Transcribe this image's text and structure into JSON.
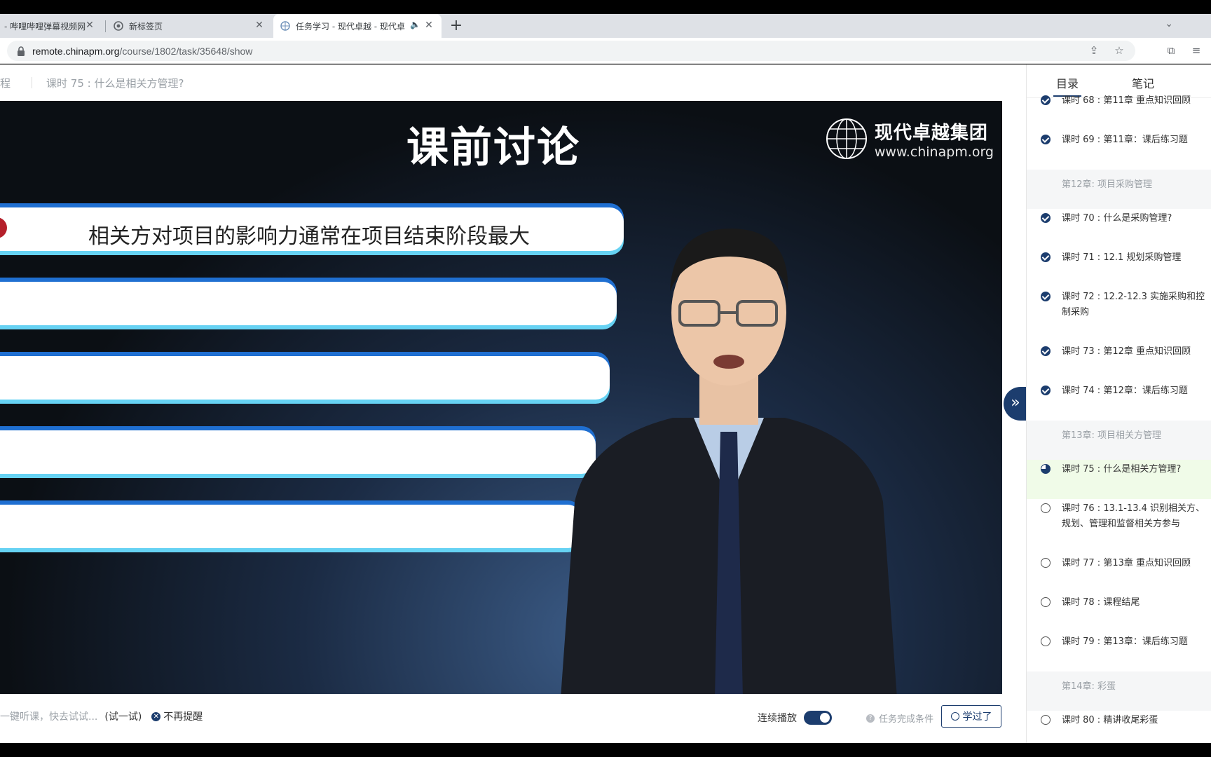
{
  "browser": {
    "tabs": [
      {
        "title": "- 哔哩哔哩弹幕视频网",
        "active": false
      },
      {
        "title": "新标签页",
        "active": false
      },
      {
        "title": "任务学习 - 现代卓越 - 现代卓",
        "active": true
      }
    ],
    "new_tab": "+",
    "url_host": "remote.chinapm.org",
    "url_path": "/course/1802/task/35648/show"
  },
  "page": {
    "crumb_left": "程",
    "crumb_title": "课时 75 : 什么是相关方管理?"
  },
  "slide": {
    "title": "课前讨论",
    "logo_name": "现代卓越集团",
    "logo_url": "www.chinapm.org",
    "statement": "相关方对项目的影响力通常在项目结束阶段最大"
  },
  "controls": {
    "hint": "一键听课，快去试试...",
    "try_label": "(试一试)",
    "no_remind": "不再提醒",
    "autoplay_label": "连续播放",
    "autoplay_on": true,
    "completion_label": "任务完成条件",
    "learned_label": "学过了"
  },
  "sidebar": {
    "tab_catalog": "目录",
    "tab_notes": "笔记",
    "items": [
      {
        "type": "lesson",
        "status": "done",
        "label": "课时 68 : 第11章 重点知识回顾"
      },
      {
        "type": "lesson",
        "status": "done",
        "label": "课时 69 : 第11章：课后练习题"
      },
      {
        "type": "chapter",
        "label": "第12章: 项目采购管理"
      },
      {
        "type": "lesson",
        "status": "done",
        "label": "课时 70 : 什么是采购管理?"
      },
      {
        "type": "lesson",
        "status": "done",
        "label": "课时 71 : 12.1 规划采购管理"
      },
      {
        "type": "lesson",
        "status": "done",
        "label": "课时 72 : 12.2-12.3 实施采购和控制采购"
      },
      {
        "type": "lesson",
        "status": "done",
        "label": "课时 73 : 第12章 重点知识回顾"
      },
      {
        "type": "lesson",
        "status": "done",
        "label": "课时 74 : 第12章：课后练习题"
      },
      {
        "type": "chapter",
        "label": "第13章: 项目相关方管理"
      },
      {
        "type": "lesson",
        "status": "current",
        "label": "课时 75 : 什么是相关方管理?"
      },
      {
        "type": "lesson",
        "status": "todo",
        "label": "课时 76 : 13.1-13.4 识别相关方、规划、管理和监督相关方参与"
      },
      {
        "type": "lesson",
        "status": "todo",
        "label": "课时 77 : 第13章 重点知识回顾"
      },
      {
        "type": "lesson",
        "status": "todo",
        "label": "课时 78 : 课程结尾"
      },
      {
        "type": "lesson",
        "status": "todo",
        "label": "课时 79 : 第13章：课后练习题"
      },
      {
        "type": "chapter",
        "label": "第14章: 彩蛋"
      },
      {
        "type": "lesson",
        "status": "todo",
        "label": "课时 80 : 精讲收尾彩蛋"
      }
    ]
  },
  "colors": {
    "accent": "#1c3d6e",
    "current_row_bg": "#f0fbe8",
    "slide_bar_blue": "#1f6fd1",
    "slide_bar_cyan": "#66d2f3"
  }
}
